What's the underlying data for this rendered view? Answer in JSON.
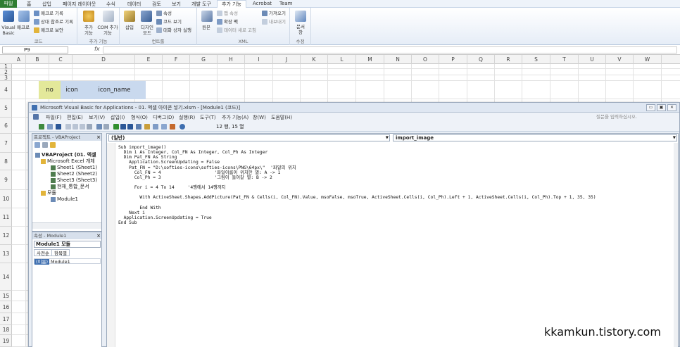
{
  "excel": {
    "ribbon_tabs": [
      "파일",
      "홈",
      "삽입",
      "페이지 레이아웃",
      "수식",
      "데이터",
      "검토",
      "보기",
      "개발 도구",
      "추가 기능",
      "Acrobat",
      "Team"
    ],
    "code_group": {
      "visual_basic": "Visual Basic",
      "macro": "매크로",
      "record_macro": "매크로 기록",
      "relative_ref": "상대 참조로 기록",
      "macro_security": "매크로 보안",
      "label": "코드"
    },
    "addins_group": {
      "addins": "추가 기능",
      "com_addins": "COM 추가 기능",
      "label": "추가 기능"
    },
    "controls_group": {
      "insert": "삽입",
      "design_mode": "디자인 모드",
      "properties": "속성",
      "view_code": "코드 보기",
      "run_dialog": "대화 상자 실행",
      "label": "컨트롤"
    },
    "xml_group": {
      "source": "원본",
      "map_props": "맵 속성",
      "expansion_packs": "확장 팩",
      "refresh_data": "데이터 새로 고침",
      "import": "가져오기",
      "export": "내보내기",
      "label": "XML"
    },
    "modify_group": {
      "document_panel": "문서 창",
      "label": "수정"
    },
    "name_box": "P9",
    "fx": "fx",
    "columns": [
      "A",
      "B",
      "C",
      "D",
      "E",
      "F",
      "G",
      "H",
      "I",
      "J",
      "K",
      "L",
      "M",
      "N",
      "O",
      "P",
      "Q",
      "R",
      "S",
      "T",
      "U",
      "V",
      "W"
    ],
    "rows": [
      "1",
      "2",
      "3",
      "4",
      "5",
      "6",
      "7",
      "8",
      "9",
      "10",
      "11",
      "12",
      "13",
      "14",
      "15",
      "16",
      "17",
      "18",
      "19"
    ],
    "cells": {
      "b3": "no",
      "c3": "icon",
      "d3": "icon_name"
    }
  },
  "vbe": {
    "title": "Microsoft Visual Basic for Applications - 01. 엑셀 아이콘 넣기.xlsm - [Module1 (코드)]",
    "menu": [
      "파일(F)",
      "편집(E)",
      "보기(V)",
      "삽입(I)",
      "형식(O)",
      "디버그(D)",
      "실행(R)",
      "도구(T)",
      "추가 기능(A)",
      "창(W)",
      "도움말(H)"
    ],
    "help_placeholder": "질문을 입력하십시오.",
    "cursor_position": "12 행, 15 열",
    "project": {
      "header": "프로젝트 - VBAProject",
      "root": "VBAProject (01. 엑셀",
      "excel_objects": "Microsoft Excel 개체",
      "sheets": [
        "Sheet1 (Sheet1)",
        "Sheet2 (Sheet2)",
        "Sheet3 (Sheet3)"
      ],
      "workbook": "현재_통합_문서",
      "modules_folder": "모듈",
      "module": "Module1"
    },
    "properties": {
      "header": "속성 - Module1",
      "object": "Module1 모듈",
      "tab_alpha": "사전순",
      "tab_category": "항목별",
      "name_key": "(이름)",
      "name_value": "Module1"
    },
    "code_window": {
      "object_combo": "(일반)",
      "proc_combo": "import_image",
      "lines": [
        "Sub import_image()",
        "  Dim i As Integer, Col_FN As Integer, Col_Ph As Integer",
        "  Dim Pat_FN As String",
        "    Application.ScreenUpdating = False",
        "    Pat_FN = \"D:\\softies-icons\\softies-icons\\PNG\\64px\\\"  '파일의 위치",
        "      Col_FN = 4                    '파일이름이 위치한 열: A -> 1",
        "      Col_Ph = 3                    '그림이 들어갈 열: B -> 2",
        "",
        "      For i = 4 To 14     '4행에서 14행까지",
        "",
        "        With ActiveSheet.Shapes.AddPicture(Pat_FN & Cells(i, Col_FN).Value, msoFalse, msoTrue, ActiveSheet.Cells(i, Col_Ph).Left + 1, ActiveSheet.Cells(i, Col_Ph).Top + 1, 35, 35)",
        "",
        "        End With",
        "    Next i",
        "  Application.ScreenUpdating = True",
        "End Sub"
      ]
    }
  },
  "watermark": "kkamkun.tistory.com",
  "colors": {
    "accent_file": "#2e7d32",
    "header_cell": "#c9d9ee",
    "no_cell": "#e3e89a"
  }
}
